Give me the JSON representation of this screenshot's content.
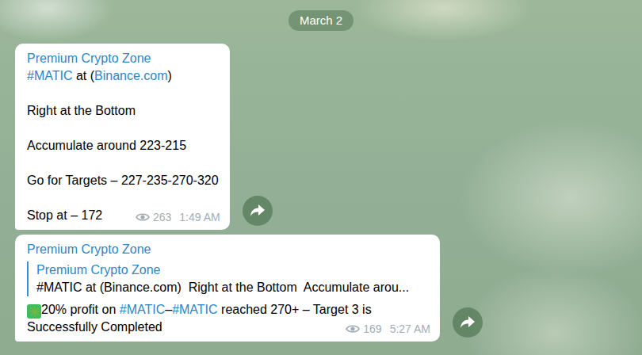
{
  "date": "March 2",
  "messages": [
    {
      "sender": "Premium Crypto Zone",
      "reply": null,
      "paragraphs": [
        [
          {
            "text": "#MATIC",
            "kind": "link"
          },
          {
            "text": " at (",
            "kind": "text"
          },
          {
            "text": "Binance.com",
            "kind": "link"
          },
          {
            "text": ")",
            "kind": "text"
          }
        ],
        [
          {
            "text": "Right at the Bottom",
            "kind": "text"
          }
        ],
        [
          {
            "text": "Accumulate around 223-215",
            "kind": "text"
          }
        ],
        [
          {
            "text": "Go for Targets – 227-235-270-320",
            "kind": "text"
          }
        ],
        [
          {
            "text": "Stop at – 172",
            "kind": "text"
          }
        ]
      ],
      "views": "263",
      "time": "1:49 AM"
    },
    {
      "sender": "Premium Crypto Zone",
      "reply": {
        "sender": "Premium Crypto Zone",
        "text": "#MATIC at (Binance.com)  Right at the Bottom  Accumulate arou..."
      },
      "paragraphs": [
        [
          {
            "text": "✳️",
            "kind": "emoji"
          },
          {
            "text": "20% profit on ",
            "kind": "text"
          },
          {
            "text": "#MATIC",
            "kind": "link"
          },
          {
            "text": "–",
            "kind": "text"
          },
          {
            "text": "#MATIC",
            "kind": "link"
          },
          {
            "text": " reached 270+ – Target 3 is Successfully Completed",
            "kind": "text"
          }
        ]
      ],
      "views": "169",
      "time": "5:27 AM"
    }
  ]
}
